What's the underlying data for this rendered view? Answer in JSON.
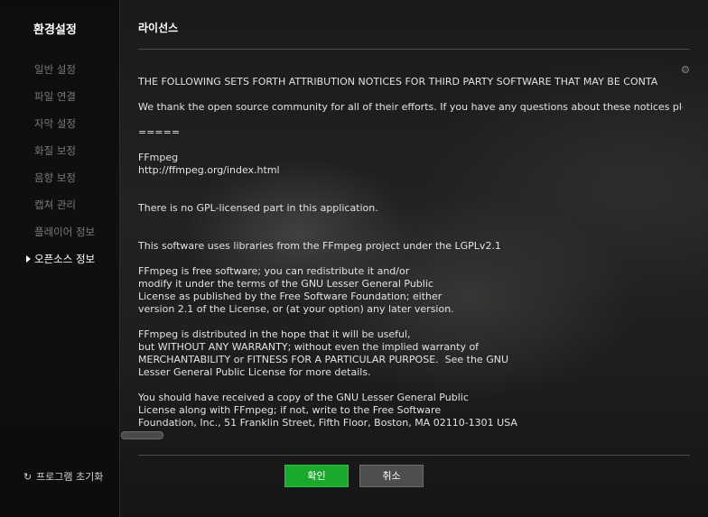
{
  "sidebar": {
    "title": "환경설정",
    "items": [
      {
        "label": "일반 설정"
      },
      {
        "label": "파일 연결"
      },
      {
        "label": "자막 설정"
      },
      {
        "label": "화질 보정"
      },
      {
        "label": "음향 보정"
      },
      {
        "label": "캡쳐 관리"
      },
      {
        "label": "플레이어 정보"
      },
      {
        "label": "오픈소스 정보"
      }
    ],
    "active_index": 7,
    "reset_label": "프로그램 초기화",
    "reset_icon": "refresh-icon"
  },
  "main": {
    "title": "라이선스",
    "license_text": "THE FOLLOWING SETS FORTH ATTRIBUTION NOTICES FOR THIRD PARTY SOFTWARE THAT MAY BE CONTA\n\nWe thank the open source community for all of their efforts. If you have any questions about these notices plea\n\n=====\n\nFFmpeg\nhttp://ffmpeg.org/index.html\n\n\nThere is no GPL-licensed part in this application.\n\n\nThis software uses libraries from the FFmpeg project under the LGPLv2.1\n\nFFmpeg is free software; you can redistribute it and/or\nmodify it under the terms of the GNU Lesser General Public\nLicense as published by the Free Software Foundation; either\nversion 2.1 of the License, or (at your option) any later version.\n\nFFmpeg is distributed in the hope that it will be useful,\nbut WITHOUT ANY WARRANTY; without even the implied warranty of\nMERCHANTABILITY or FITNESS FOR A PARTICULAR PURPOSE.  See the GNU\nLesser General Public License for more details.\n\nYou should have received a copy of the GNU Lesser General Public\nLicense along with FFmpeg; if not, write to the Free Software\nFoundation, Inc., 51 Franklin Street, Fifth Floor, Boston, MA 02110-1301 USA"
  },
  "buttons": {
    "ok_label": "확인",
    "cancel_label": "취소"
  },
  "colors": {
    "ok_button": "#1aa82d",
    "cancel_button": "#4e4e4e",
    "active_text": "#ffffff",
    "inactive_text": "#7a7a7a"
  }
}
